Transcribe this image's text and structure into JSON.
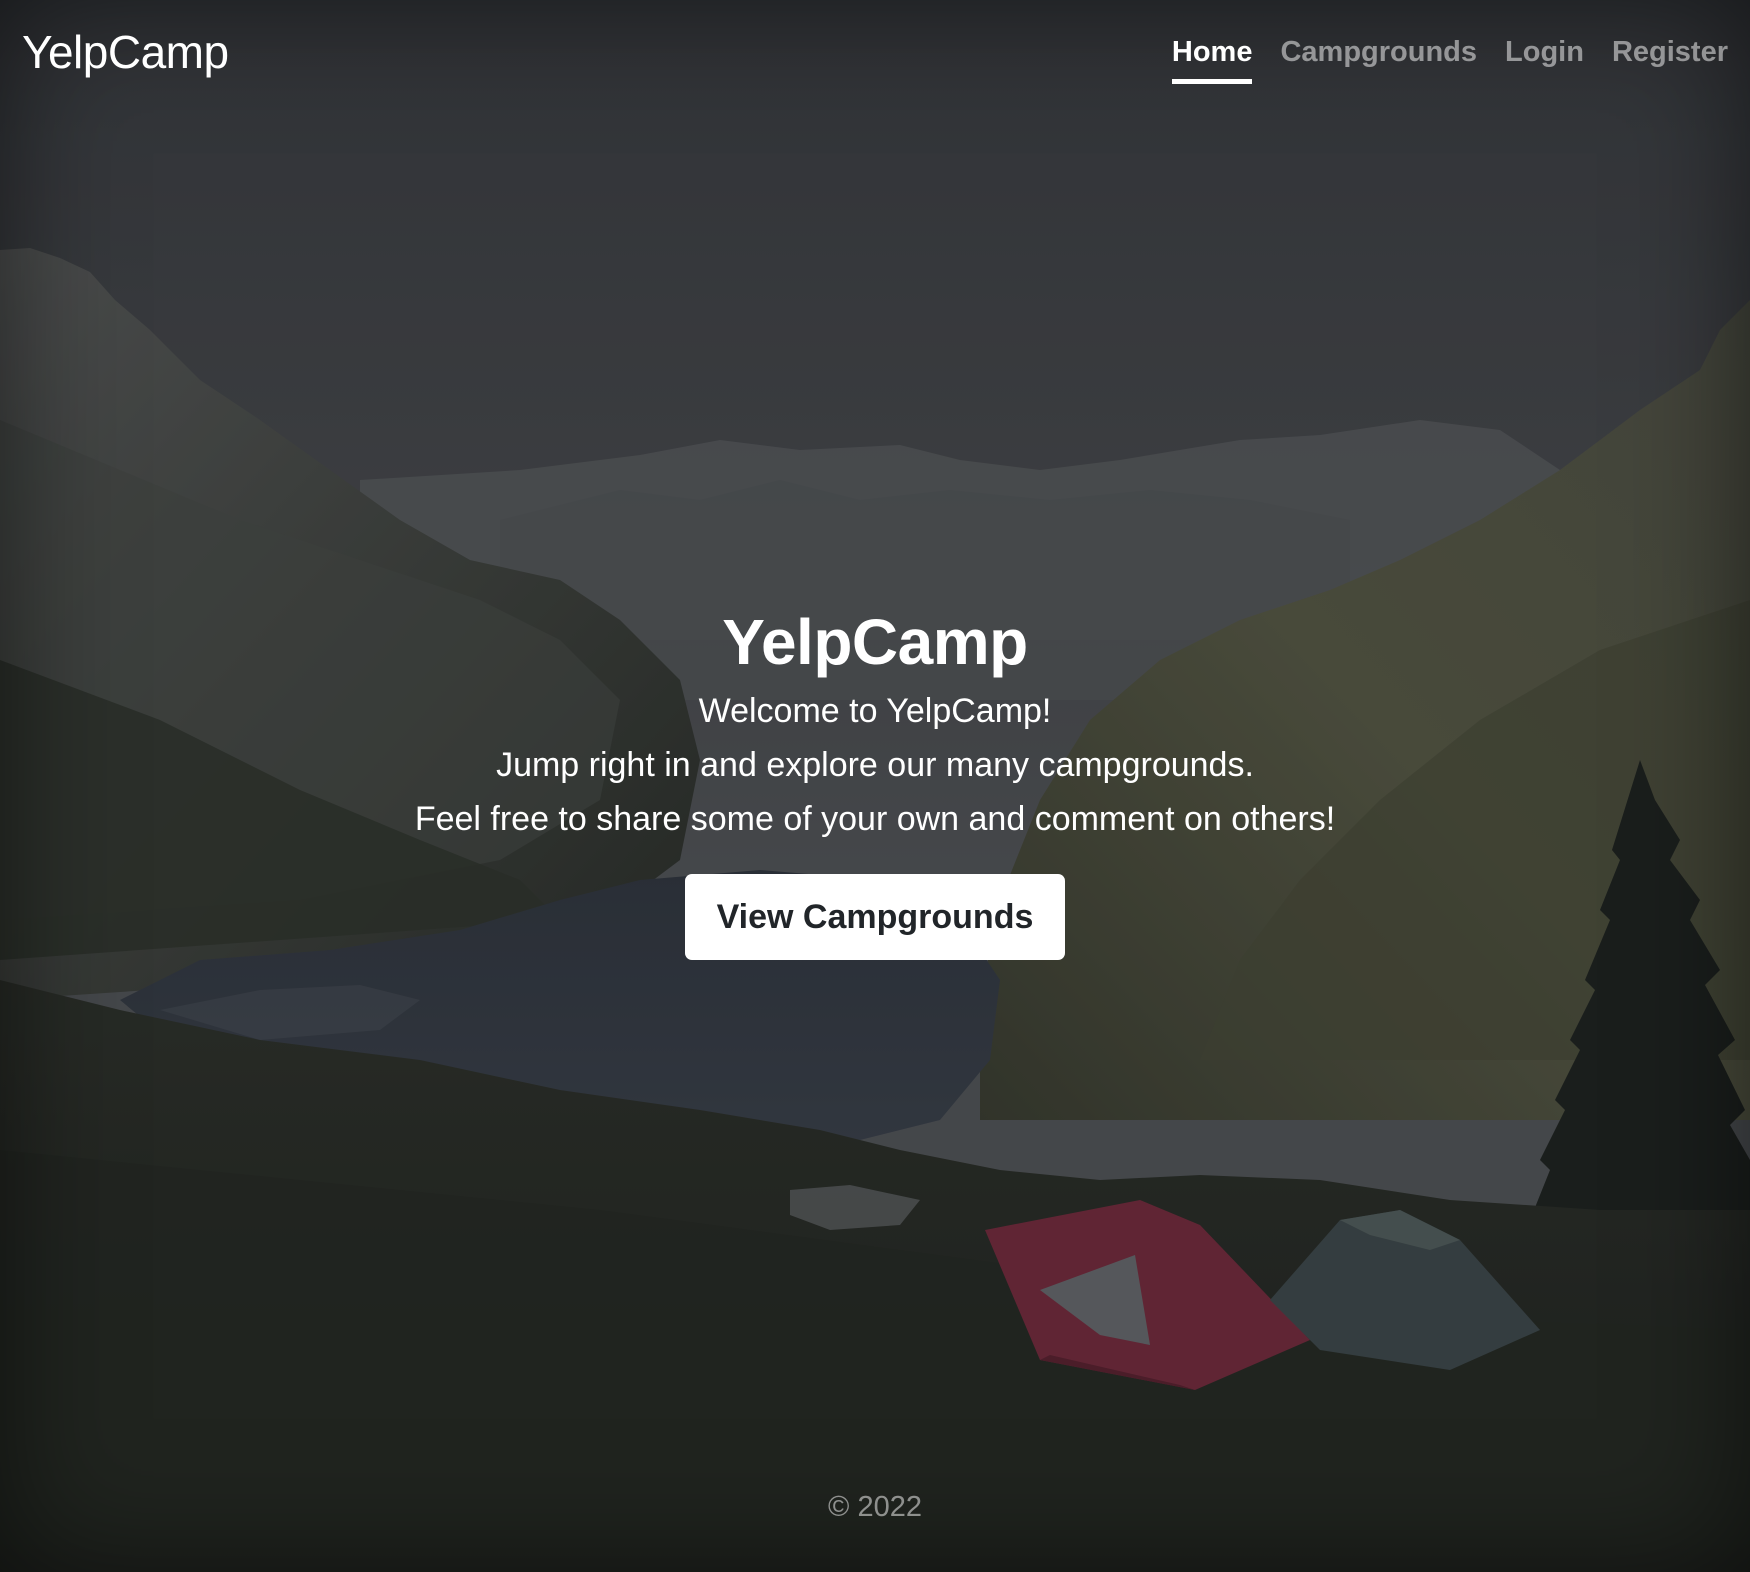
{
  "navbar": {
    "brand": "YelpCamp",
    "links": [
      {
        "label": "Home",
        "active": true
      },
      {
        "label": "Campgrounds",
        "active": false
      },
      {
        "label": "Login",
        "active": false
      },
      {
        "label": "Register",
        "active": false
      }
    ]
  },
  "hero": {
    "title": "YelpCamp",
    "lines": [
      "Welcome to YelpCamp!",
      "Jump right in and explore our many campgrounds.",
      "Feel free to share some of your own and comment on others!"
    ],
    "cta_label": "View Campgrounds"
  },
  "footer": {
    "copyright": "© 2022"
  },
  "colors": {
    "text": "#ffffff",
    "muted_text": "rgba(255,255,255,0.5)",
    "button_bg": "#ffffff",
    "button_text": "#212529"
  }
}
